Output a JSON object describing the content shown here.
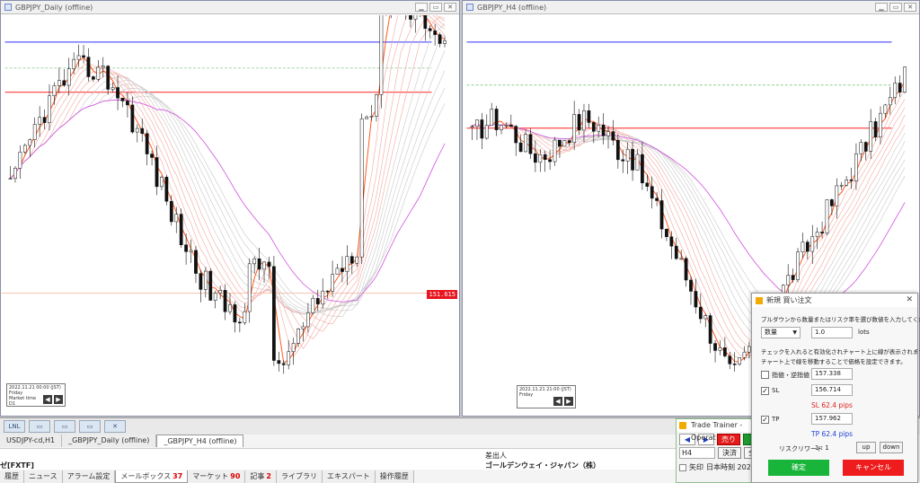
{
  "windows": {
    "left": {
      "title": "GBPJPY_Daily (offline)",
      "price_tag": "151.615",
      "info": {
        "line1": "2022.11.21 00:00 (JST)",
        "line2": "Friday",
        "line3": "Market time",
        "line4": "D1"
      }
    },
    "right": {
      "title": "GBPJPY_H4 (offline)",
      "info": {
        "line1": "2022.11.21 21:00 (JST)",
        "line2": "Friday",
        "line3": "",
        "line4": ""
      }
    }
  },
  "colors": {
    "buy_green": "#19b53a",
    "sell_red": "#ee1c1c",
    "sl_red": "#e02020",
    "tp_blue": "#2040d8",
    "blue_line": "#2222ff"
  },
  "bottom": {
    "toolbox_icons": [
      "LNL",
      "▭",
      "▭",
      "▭",
      "✕"
    ],
    "chart_tabs": [
      "USDJPY-cd,H1",
      "_GBPJPY_Daily (offline)",
      "_GBPJPY_H4 (offline)"
    ],
    "active_chart_tab": 2,
    "news": {
      "col_left": "ゼ[FXTF]",
      "col_header": "差出人",
      "col_sender": "ゴールデンウェイ・ジャパン（株）"
    },
    "term_tabs": [
      {
        "label": "履歴",
        "count": ""
      },
      {
        "label": "ニュース",
        "count": ""
      },
      {
        "label": "アラーム設定",
        "count": ""
      },
      {
        "label": "メールボックス",
        "count": "37"
      },
      {
        "label": "マーケット",
        "count": "90"
      },
      {
        "label": "記事",
        "count": "2"
      },
      {
        "label": "ライブラリ",
        "count": ""
      },
      {
        "label": "エキスパート",
        "count": ""
      },
      {
        "label": "操作履歴",
        "count": ""
      }
    ]
  },
  "trainer": {
    "title": "Trade Trainer - Operat",
    "prev": "◀",
    "next": "▶",
    "sell": "売り",
    "settle": "決済",
    "all": "全",
    "timeframe": "H4",
    "arrow_label": "矢印",
    "time_label": "日本時刻 2022/("
  },
  "dialog": {
    "title": "新規 買い注文",
    "close": "✕",
    "instruction": "プルダウンから数量またはリスク率を選び数値を入力してください。",
    "qty_mode": "数量",
    "qty_value": "1.0",
    "qty_unit": "lots",
    "note1": "チェックを入れると有効化されチャート上に線が表示されます。",
    "note2": "チャート上で線を移動することで価格を設定できます。",
    "limit": {
      "label": "指値・逆指値",
      "value": "157.338",
      "checked": false
    },
    "sl": {
      "label": "SL",
      "value": "156.714",
      "checked": true,
      "pips": "SL 62.4 pips"
    },
    "tp": {
      "label": "TP",
      "value": "157.962",
      "checked": true,
      "pips": "TP 62.4 pips"
    },
    "risk_reward_label": "リスクリワード",
    "risk_reward_value": "1 : 1",
    "up": "up",
    "down": "down",
    "ok": "確定",
    "cancel": "キャンセル"
  }
}
